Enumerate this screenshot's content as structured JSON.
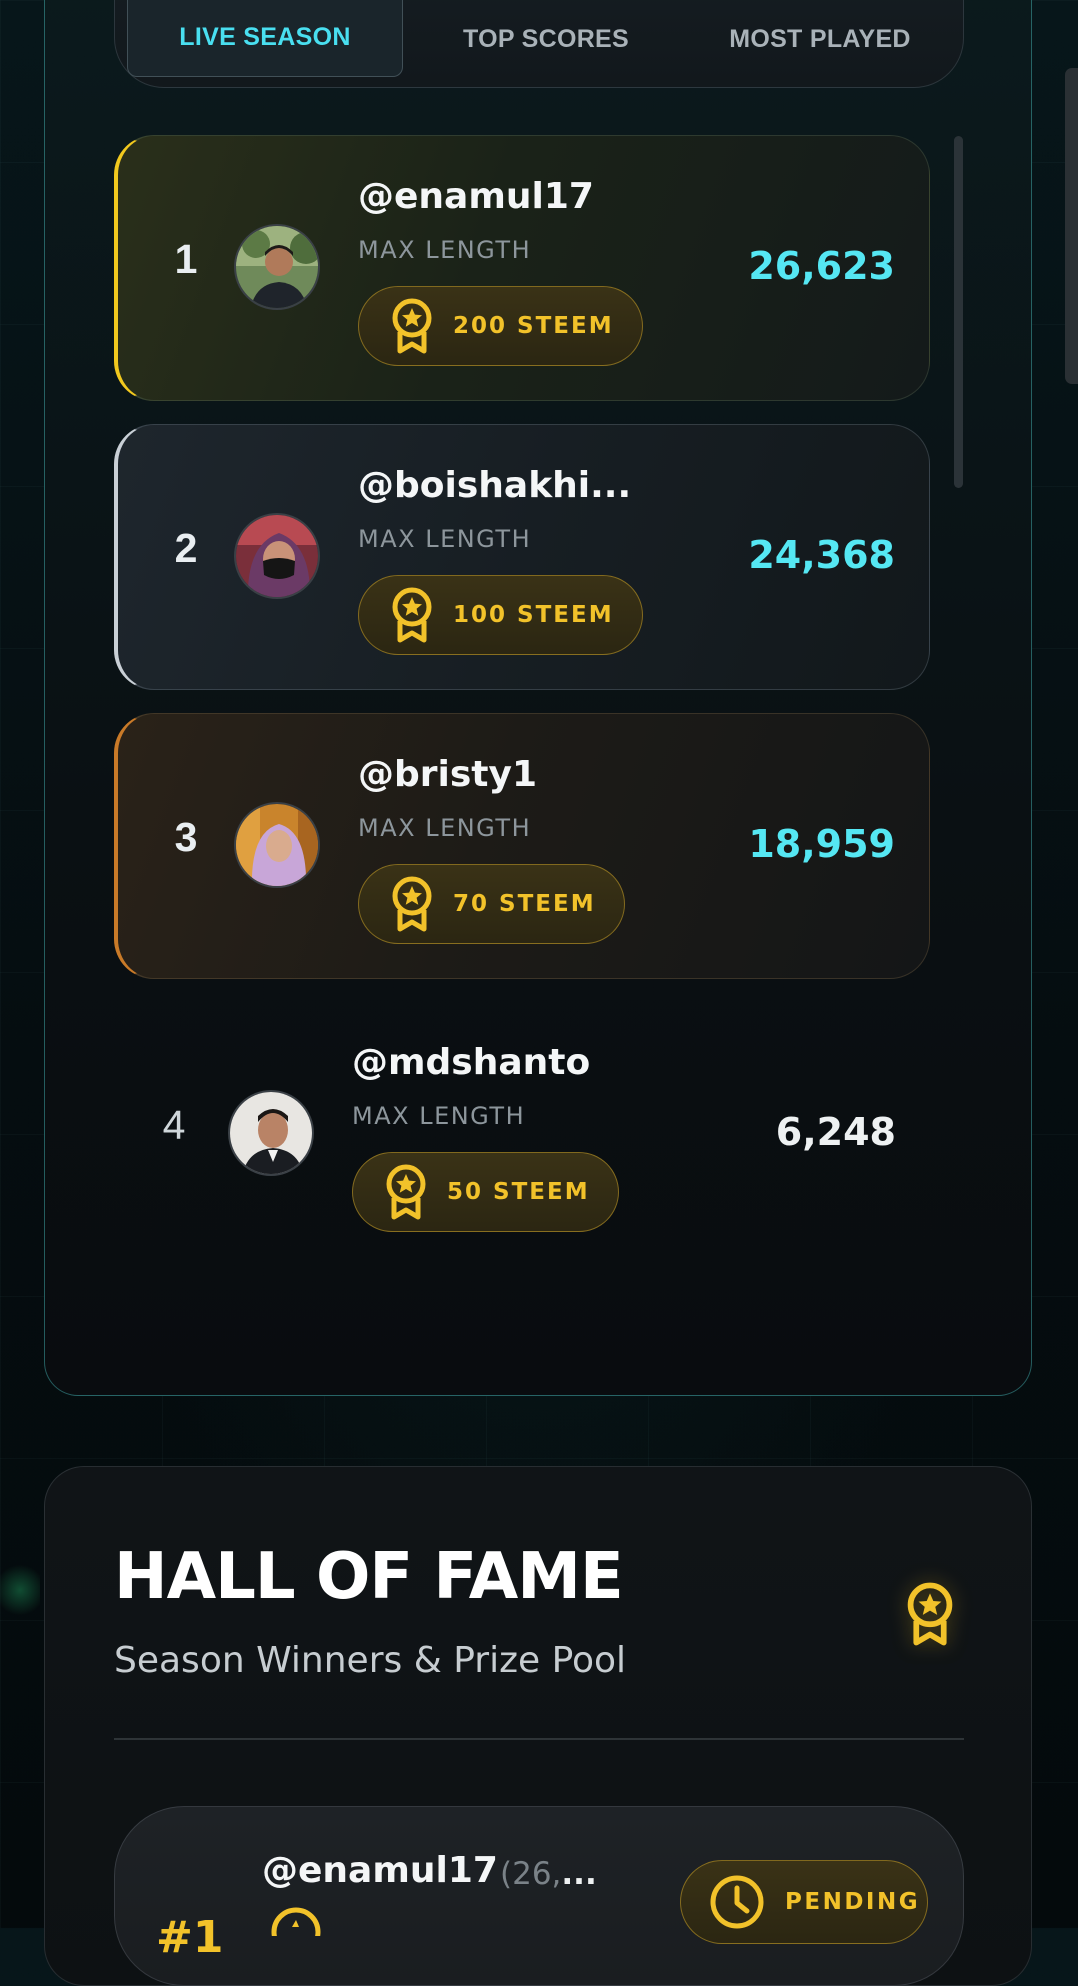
{
  "tabs": [
    {
      "label": "LIVE SEASON",
      "active": true
    },
    {
      "label": "TOP SCORES",
      "active": false
    },
    {
      "label": "MOST PLAYED",
      "active": false
    }
  ],
  "leaderboard": {
    "entries": [
      {
        "rank": "1",
        "username": "@enamul17",
        "metric": "MAX LENGTH",
        "prize": "200 STEEM",
        "score": "26,623",
        "accent": "#f2c91e"
      },
      {
        "rank": "2",
        "username": "@boishakhi...",
        "metric": "MAX LENGTH",
        "prize": "100 STEEM",
        "score": "24,368",
        "accent": "#c9d0d6"
      },
      {
        "rank": "3",
        "username": "@bristy1",
        "metric": "MAX LENGTH",
        "prize": "70 STEEM",
        "score": "18,959",
        "accent": "#c97a28"
      },
      {
        "rank": "4",
        "username": "@mdshanto",
        "metric": "MAX LENGTH",
        "prize": "50 STEEM",
        "score": "6,248",
        "accent": ""
      }
    ]
  },
  "hall_of_fame": {
    "title": "HALL OF FAME",
    "subtitle": "Season Winners & Prize Pool",
    "winners": [
      {
        "rank": "#1",
        "username": "@enamul17",
        "score_prefix": "(26,",
        "score_ellipsis": "...",
        "status": "PENDING"
      }
    ]
  },
  "colors": {
    "accent_cyan": "#49dff0",
    "gold": "#f2c22a",
    "score_cyan": "#55e7f3"
  },
  "icons": {
    "prize": "medal-star-icon",
    "hall_of_fame": "medal-star-icon",
    "status": "clock-icon"
  }
}
